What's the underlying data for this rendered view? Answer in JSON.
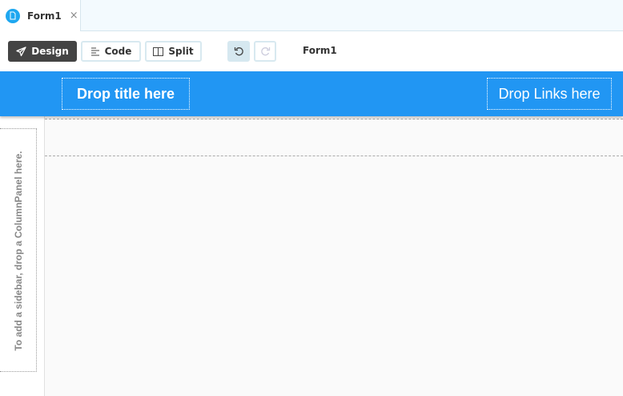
{
  "tab": {
    "label": "Form1",
    "close": "×",
    "icon": "form-file-icon"
  },
  "toolbar": {
    "design": "Design",
    "code": "Code",
    "split": "Split",
    "form_name": "Form1"
  },
  "header": {
    "title_drop": "Drop title here",
    "links_drop": "Drop Links here",
    "color": "#2196f3"
  },
  "sidebar": {
    "hint": "To add a sidebar, drop a ColumnPanel here."
  }
}
